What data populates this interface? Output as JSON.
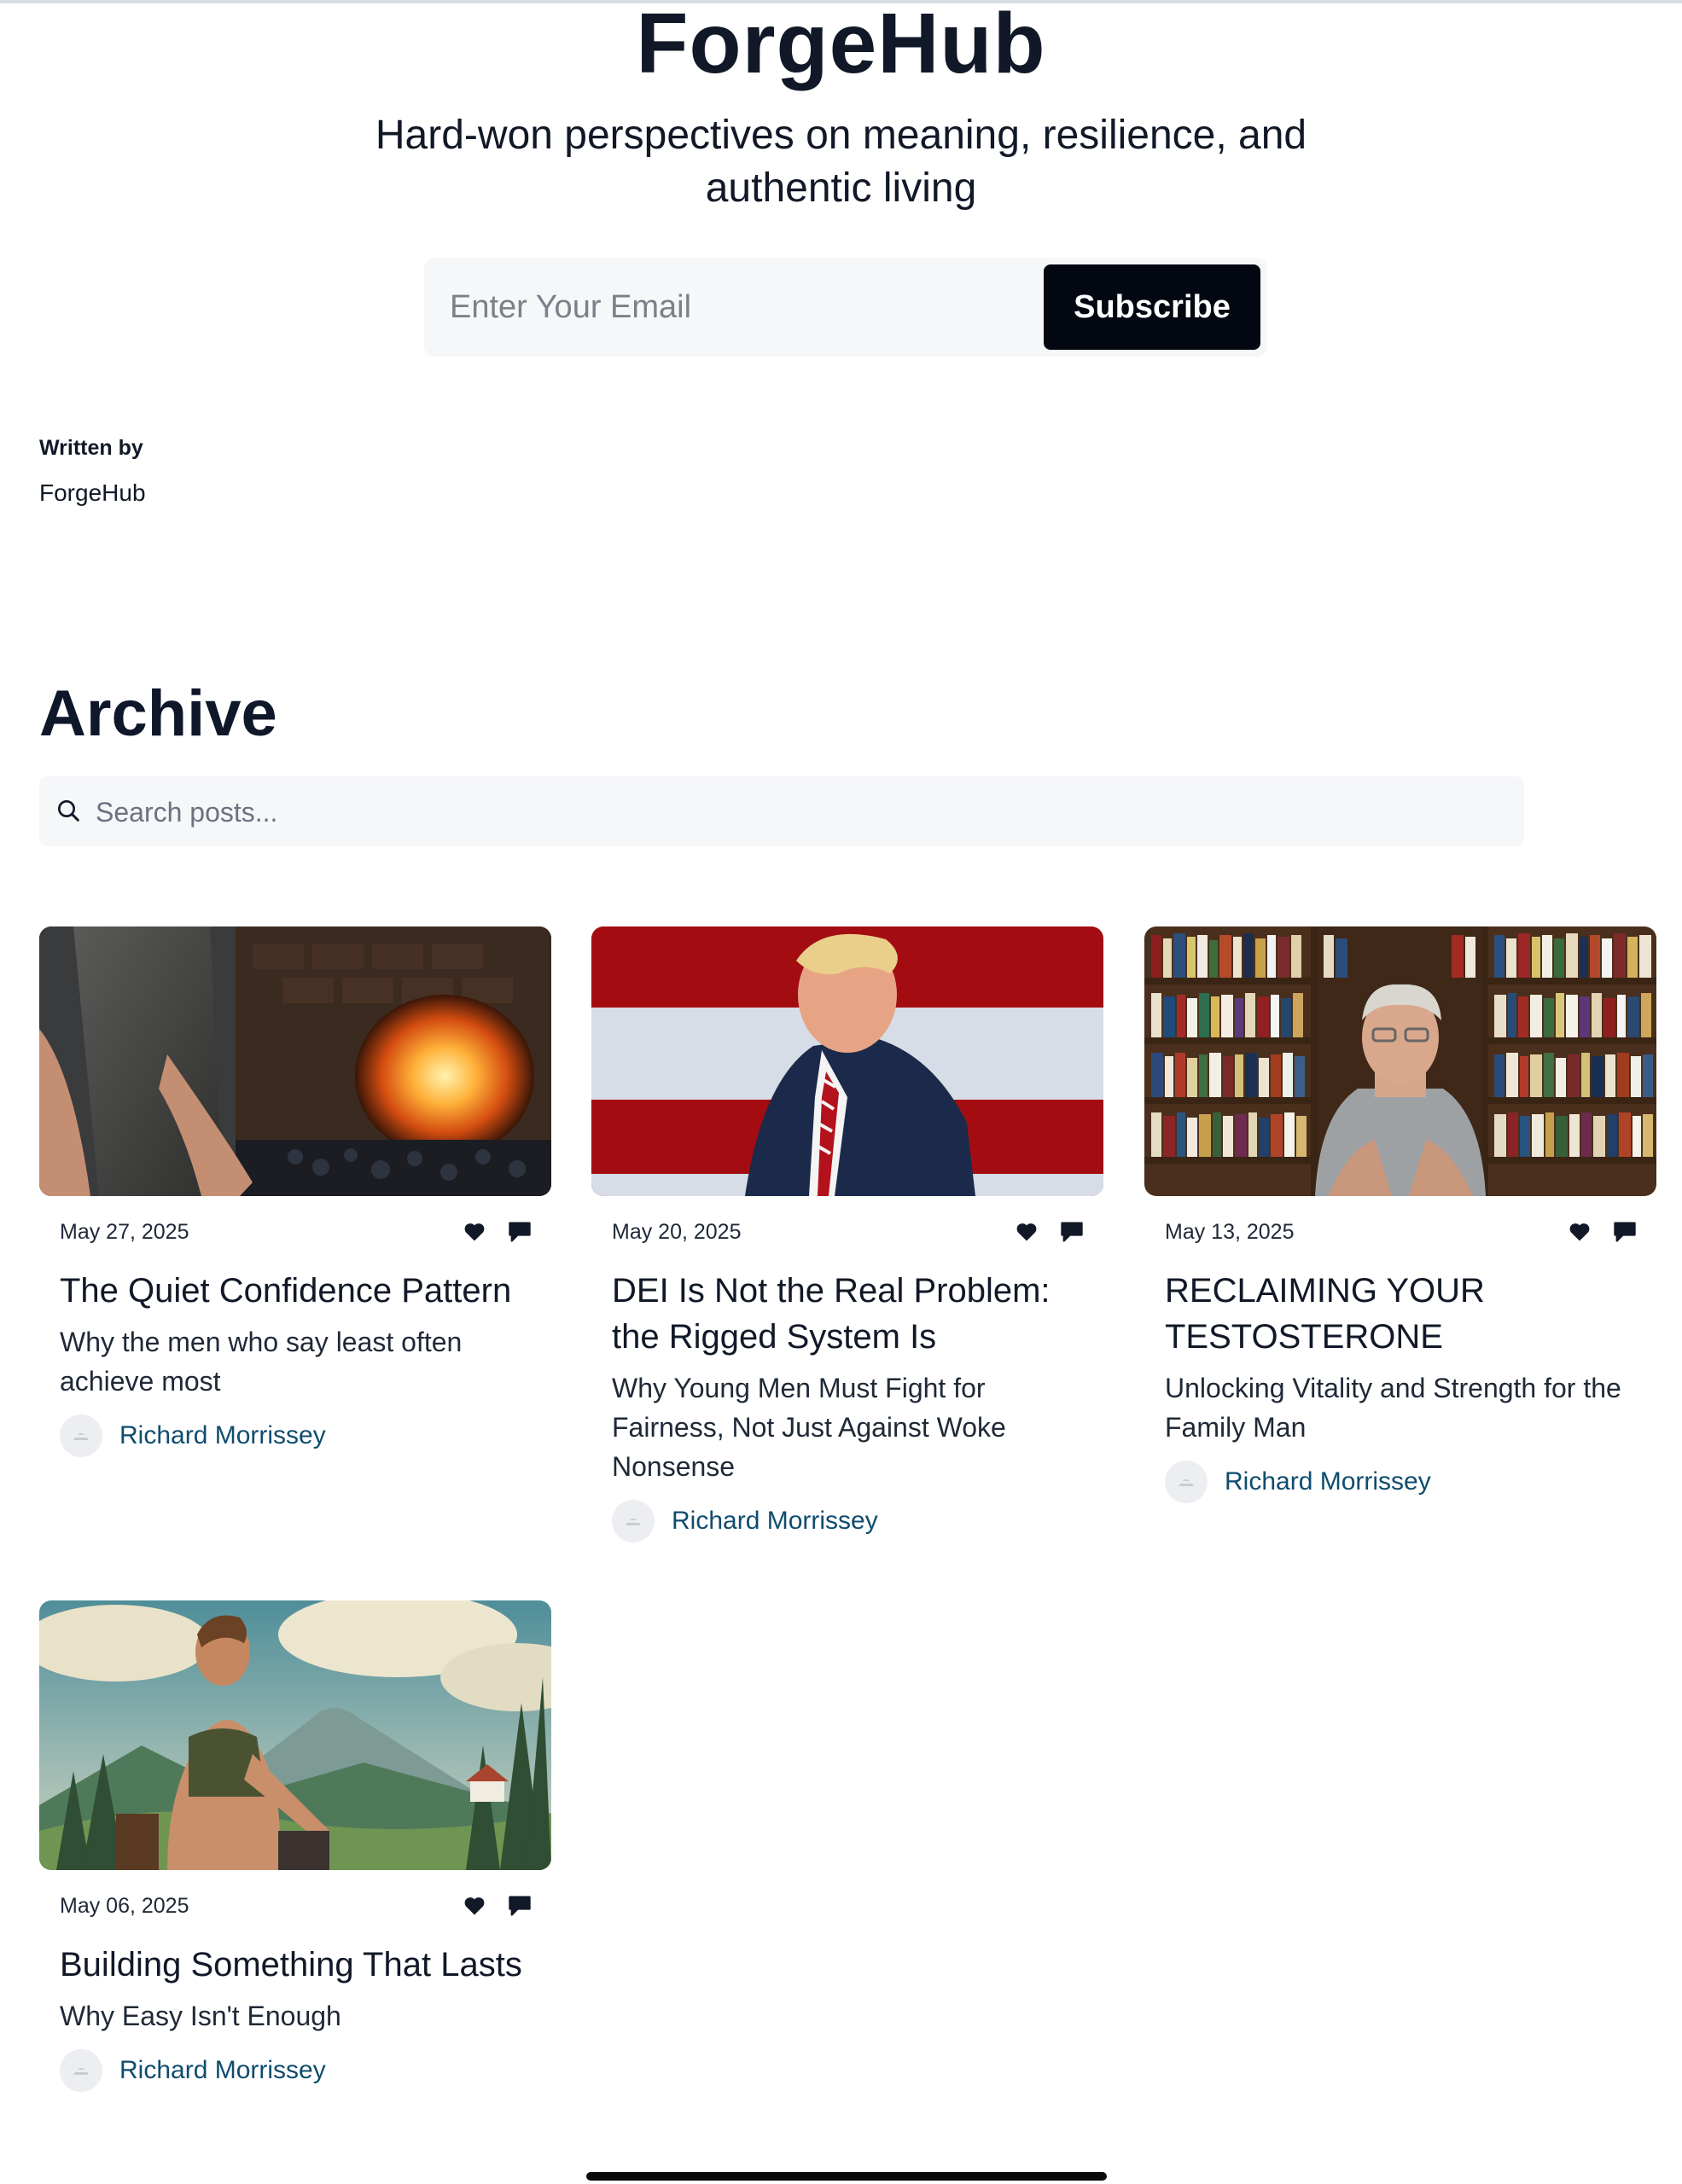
{
  "site": {
    "title": "ForgeHub",
    "tagline": "Hard-won perspectives on meaning, resilience, and authentic living"
  },
  "subscribe": {
    "placeholder": "Enter Your Email",
    "button_label": "Subscribe"
  },
  "byline": {
    "label": "Written by",
    "name": "ForgeHub"
  },
  "archive": {
    "heading": "Archive",
    "search_placeholder": "Search posts..."
  },
  "posts": [
    {
      "date": "May 27, 2025",
      "title": "The Quiet Confidence Pattern",
      "subtitle": "Why the men who say least often achieve most",
      "author": "Richard Morrissey",
      "image": "blacksmith-forge-photo"
    },
    {
      "date": "May 20, 2025",
      "title": "DEI Is Not the Real Problem: the Rigged System Is",
      "subtitle": "Why Young Men Must Fight for Fairness, Not Just Against Woke Nonsense",
      "author": "Richard Morrissey",
      "image": "man-in-suit-flag-photo"
    },
    {
      "date": "May 13, 2025",
      "title": "RECLAIMING YOUR TESTOSTERONE",
      "subtitle": "Unlocking Vitality and Strength for the Family Man",
      "author": "Richard Morrissey",
      "image": "man-bookshelf-photo"
    },
    {
      "date": "May 06, 2025",
      "title": "Building Something That Lasts",
      "subtitle": "Why Easy Isn't Enough",
      "author": "Richard Morrissey",
      "image": "man-mountain-illustration"
    }
  ],
  "icons": {
    "like": "heart-icon",
    "comment": "comment-icon",
    "search": "search-icon"
  },
  "colors": {
    "accent_button": "#030712",
    "author_link": "#0f4c6e",
    "input_background": "#f6f7f9"
  }
}
